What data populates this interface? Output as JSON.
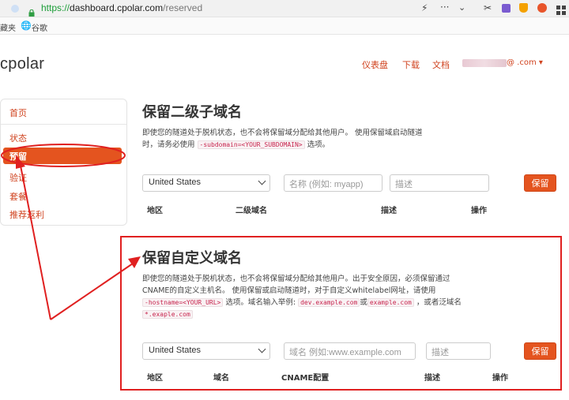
{
  "browser": {
    "url_protocol": "https://",
    "url_host": "dashboard.cpolar.com",
    "url_path": "/reserved",
    "bookmark_partial": "藏夹",
    "bookmark_google": "谷歌"
  },
  "header": {
    "logo": "cpolar",
    "nav": [
      "仪表盘",
      "下载",
      "文档"
    ],
    "account_suffix": "@ .com ▾"
  },
  "sidebar": {
    "items": [
      "首页",
      "状态",
      "预留",
      "验证",
      "套餐",
      "推荐返利"
    ],
    "active": "预留"
  },
  "section1": {
    "title": "保留二级子域名",
    "desc_1": "即使您的隧道处于脱机状态，也不会将保留域分配给其他用户。 使用保留域启动隧道",
    "desc_2a": "时，请务必使用",
    "desc_code": "-subdomain=<YOUR_SUBDOMAIN>",
    "desc_2b": "选项。",
    "region_value": "United States",
    "name_placeholder": "名称 (例如: myapp)",
    "desc_placeholder": "描述",
    "save_label": "保留",
    "columns": [
      "地区",
      "二级域名",
      "描述",
      "操作"
    ]
  },
  "section2": {
    "title": "保留自定义域名",
    "desc_1": "即使您的隧道处于脱机状态，也不会将保留域分配给其他用户。出于安全原因，必须保留通过",
    "desc_2": "CNAME的自定义主机名。 使用保留或启动隧道时，对于自定义whitelabel网址，请使用",
    "desc_code1": "-hostname=<YOUR_URL>",
    "desc_3a": "选项。域名输入举例:",
    "desc_code2": "dev.example.com",
    "desc_or": "或",
    "desc_code3": "example.com",
    "desc_3b": "，或者泛域名",
    "desc_code4": "*.exaple.com",
    "region_value": "United States",
    "domain_placeholder": "域名 例如:www.example.com",
    "desc_placeholder": "描述",
    "save_label": "保留",
    "columns": [
      "地区",
      "域名",
      "CNAME配置",
      "描述",
      "操作"
    ]
  },
  "colors": {
    "accent": "#e4541f",
    "annotation": "#e02020"
  }
}
